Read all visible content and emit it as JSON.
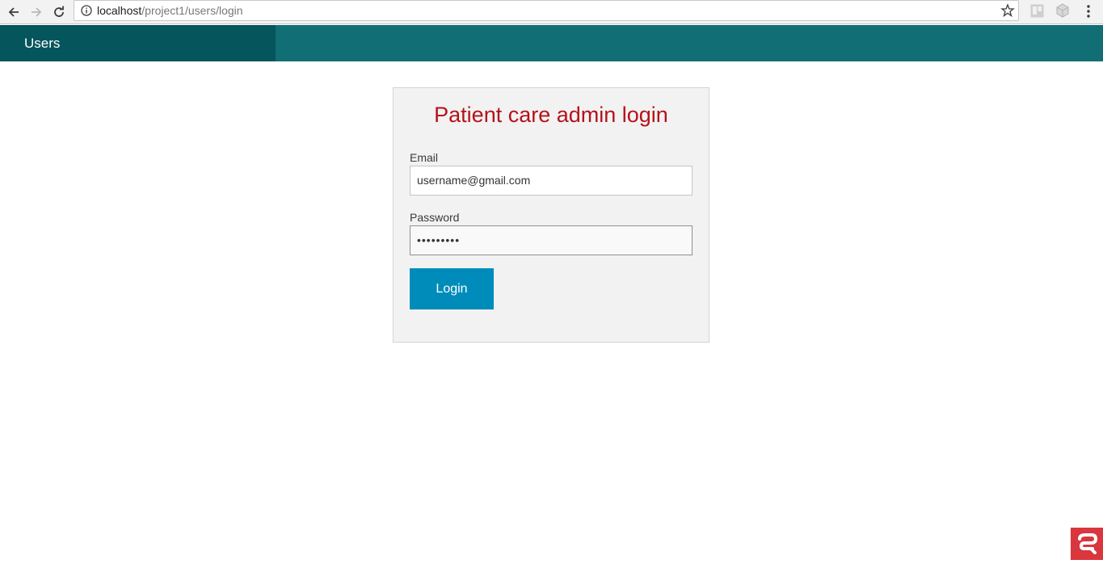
{
  "browser": {
    "url_host": "localhost",
    "url_path": "/project1/users/login"
  },
  "navbar": {
    "brand": "Users"
  },
  "login": {
    "title": "Patient care admin login",
    "email_label": "Email",
    "email_value": "username@gmail.com",
    "password_label": "Password",
    "password_value": "•••••••••",
    "button_label": "Login"
  },
  "colors": {
    "navbar": "#116e74",
    "brand": "#04555c",
    "title": "#b5121b",
    "button": "#008cba"
  },
  "icons": {
    "back": "back-arrow-icon",
    "forward": "forward-arrow-icon",
    "reload": "reload-icon",
    "info": "info-icon",
    "star": "bookmark-star-icon",
    "menu": "kebab-menu-icon"
  }
}
